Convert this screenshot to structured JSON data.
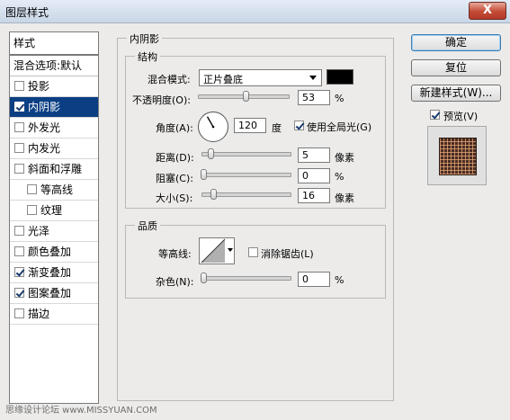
{
  "window": {
    "title": "图层样式",
    "close_label": "X"
  },
  "style_list": {
    "header": "样式",
    "blend_options": "混合选项:默认",
    "items": [
      {
        "label": "投影",
        "checked": false
      },
      {
        "label": "内阴影",
        "checked": true,
        "selected": true
      },
      {
        "label": "外发光",
        "checked": false
      },
      {
        "label": "内发光",
        "checked": false
      },
      {
        "label": "斜面和浮雕",
        "checked": false
      },
      {
        "label": "等高线",
        "checked": false,
        "sub": true
      },
      {
        "label": "纹理",
        "checked": false,
        "sub": true
      },
      {
        "label": "光泽",
        "checked": false
      },
      {
        "label": "颜色叠加",
        "checked": false
      },
      {
        "label": "渐变叠加",
        "checked": true
      },
      {
        "label": "图案叠加",
        "checked": true
      },
      {
        "label": "描边",
        "checked": false
      }
    ]
  },
  "inner_shadow": {
    "group_title": "内阴影",
    "structure": {
      "title": "结构",
      "blend_mode_label": "混合模式:",
      "blend_mode_value": "正片叠底",
      "blend_color": "#000000",
      "opacity_label": "不透明度(O):",
      "opacity_value": "53",
      "opacity_unit": "%",
      "opacity_fraction": 0.53,
      "angle_label": "角度(A):",
      "angle_value": "120",
      "angle_unit": "度",
      "global_light_label": "使用全局光(G)",
      "global_light_checked": true,
      "distance_label": "距离(D):",
      "distance_value": "5",
      "distance_unit": "像素",
      "distance_fraction": 0.02,
      "choke_label": "阻塞(C):",
      "choke_value": "0",
      "choke_unit": "%",
      "choke_fraction": 0,
      "size_label": "大小(S):",
      "size_value": "16",
      "size_unit": "像素",
      "size_fraction": 0.06
    },
    "quality": {
      "title": "品质",
      "contour_label": "等高线:",
      "antialias_label": "消除锯齿(L)",
      "antialias_checked": false,
      "noise_label": "杂色(N):",
      "noise_value": "0",
      "noise_unit": "%",
      "noise_fraction": 0
    }
  },
  "buttons": {
    "ok": "确定",
    "reset": "复位",
    "new_style": "新建样式(W)...",
    "preview_label": "预览(V)",
    "preview_checked": true
  },
  "watermark": "思缘设计论坛 www.MISSYUAN.COM"
}
